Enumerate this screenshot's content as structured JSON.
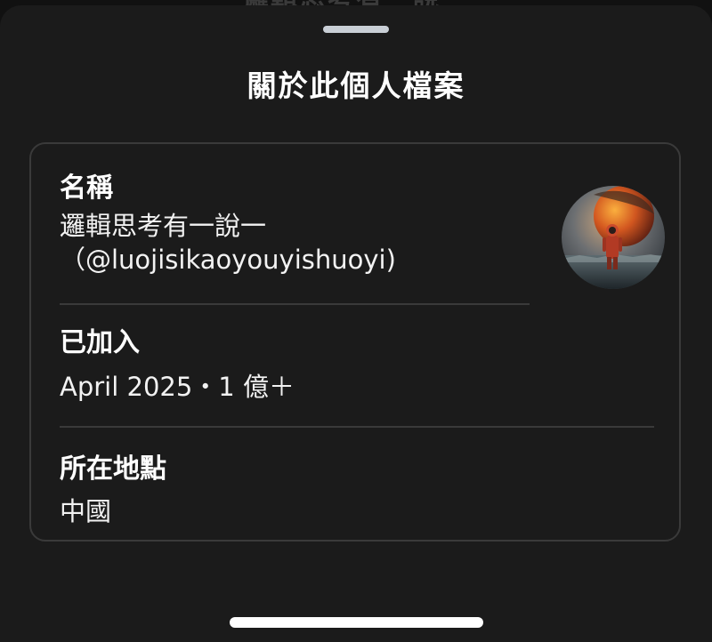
{
  "background_text": "邏輯思考有一說一",
  "sheet": {
    "title": "關於此個人檔案"
  },
  "profile": {
    "name_label": "名稱",
    "name_value": "邏輯思考有一說一",
    "handle_value": "（@luojisikaoyouyishuoyi)",
    "joined_label": "已加入",
    "joined_value": "April 2025・1 億＋",
    "location_label": "所在地點",
    "location_value": "中國"
  },
  "colors": {
    "sheet_background": "#1b1b1b",
    "text_primary": "#ffffff",
    "divider": "#3a3a3a",
    "grab_handle": "#c9cfd6"
  },
  "icons": {
    "avatar": "astronaut-planet-avatar"
  }
}
